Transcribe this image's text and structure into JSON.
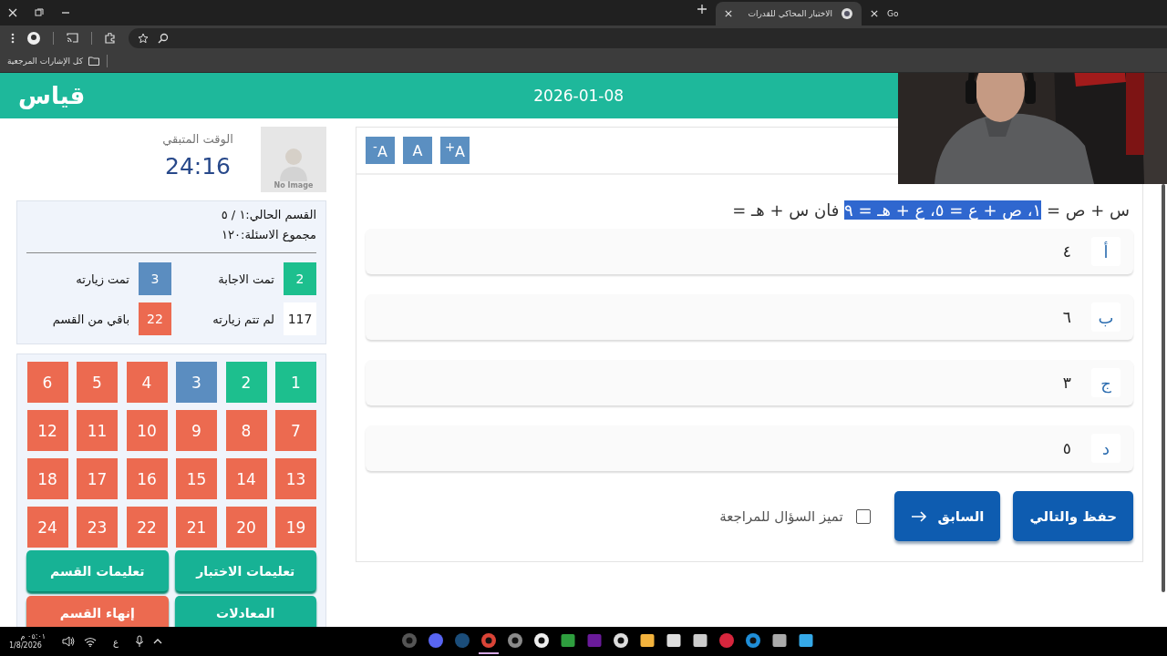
{
  "browser": {
    "tabs": [
      {
        "title": "Go",
        "selected": false
      },
      {
        "title": "الاختبار المحاكي للقدرات",
        "selected": true
      }
    ],
    "bookmarks": [
      {
        "label": "كل الإشارات المرجعية"
      }
    ]
  },
  "header": {
    "logo": "قياس",
    "date": "2026-01-08"
  },
  "timer": {
    "label": "الوقت المتبقي",
    "value": "24:16"
  },
  "avatar": {
    "caption": "No Image"
  },
  "section": {
    "current": "القسم الحالي:١ / ٥",
    "total": "مجموع الاسئلة:١٢٠"
  },
  "stats": [
    {
      "value": "2",
      "label": "تمت الاجابة",
      "color": "#1dbf8e"
    },
    {
      "value": "3",
      "label": "تمت زيارته",
      "color": "#5b8dc0"
    },
    {
      "value": "117",
      "label": "لم تتم زيارته",
      "color": "#ffffff"
    },
    {
      "value": "22",
      "label": "باقي من القسم",
      "color": "#ec6a50"
    }
  ],
  "questions": [
    {
      "number": "1",
      "color": "#1dbf8e"
    },
    {
      "number": "2",
      "color": "#1dbf8e"
    },
    {
      "number": "3",
      "color": "#5b8dc0"
    },
    {
      "number": "4",
      "color": "#ec6a50"
    },
    {
      "number": "5",
      "color": "#ec6a50"
    },
    {
      "number": "6",
      "color": "#ec6a50"
    },
    {
      "number": "7",
      "color": "#ec6a50"
    },
    {
      "number": "8",
      "color": "#ec6a50"
    },
    {
      "number": "9",
      "color": "#ec6a50"
    },
    {
      "number": "10",
      "color": "#ec6a50"
    },
    {
      "number": "11",
      "color": "#ec6a50"
    },
    {
      "number": "12",
      "color": "#ec6a50"
    },
    {
      "number": "13",
      "color": "#ec6a50"
    },
    {
      "number": "14",
      "color": "#ec6a50"
    },
    {
      "number": "15",
      "color": "#ec6a50"
    },
    {
      "number": "16",
      "color": "#ec6a50"
    },
    {
      "number": "17",
      "color": "#ec6a50"
    },
    {
      "number": "18",
      "color": "#ec6a50"
    },
    {
      "number": "19",
      "color": "#ec6a50"
    },
    {
      "number": "20",
      "color": "#ec6a50"
    },
    {
      "number": "21",
      "color": "#ec6a50"
    },
    {
      "number": "22",
      "color": "#ec6a50"
    },
    {
      "number": "23",
      "color": "#ec6a50"
    },
    {
      "number": "24",
      "color": "#ec6a50"
    }
  ],
  "side_buttons": [
    {
      "label": "تعليمات الاختبار",
      "color": "#17b295"
    },
    {
      "label": "تعليمات القسم",
      "color": "#17b295"
    },
    {
      "label": "المعادلات",
      "color": "#17b295"
    },
    {
      "label": "إنهاء القسم",
      "color": "#ec6a50"
    }
  ],
  "font_buttons": [
    {
      "label": "A$^{+}$"
    },
    {
      "label": "A"
    },
    {
      "label": "A$^{-}$"
    }
  ],
  "question": {
    "segments": [
      {
        "text": "س + ص =",
        "selected": false
      },
      {
        "text": "١، ص + ع = ٥، ع + هـ = ٩",
        "selected": true
      },
      {
        "text": "فان س + هـ =",
        "selected": false
      }
    ]
  },
  "options": [
    {
      "letter": "أ",
      "text": "٤"
    },
    {
      "letter": "ب",
      "text": "٦"
    },
    {
      "letter": "ج",
      "text": "٣"
    },
    {
      "letter": "د",
      "text": "٥"
    }
  ],
  "actions": [
    {
      "label": "حفظ والتالي",
      "kind": "next"
    },
    {
      "label": "السابق",
      "kind": "previous"
    }
  ],
  "review": {
    "label": "تميز السؤال للمراجعة",
    "checked": false
  },
  "taskbar": {
    "time": "٠٥:٠١ م",
    "date": "1/8/2026",
    "language": "ع",
    "apps": [
      {
        "selected": false
      },
      {
        "selected": false
      },
      {
        "selected": false
      },
      {
        "selected": true
      },
      {
        "selected": false
      },
      {
        "selected": false
      },
      {
        "selected": false
      },
      {
        "selected": false
      },
      {
        "selected": false
      },
      {
        "selected": false
      },
      {
        "selected": false
      },
      {
        "selected": false
      },
      {
        "selected": false
      },
      {
        "selected": false
      },
      {
        "selected": false
      },
      {
        "selected": false
      }
    ]
  }
}
